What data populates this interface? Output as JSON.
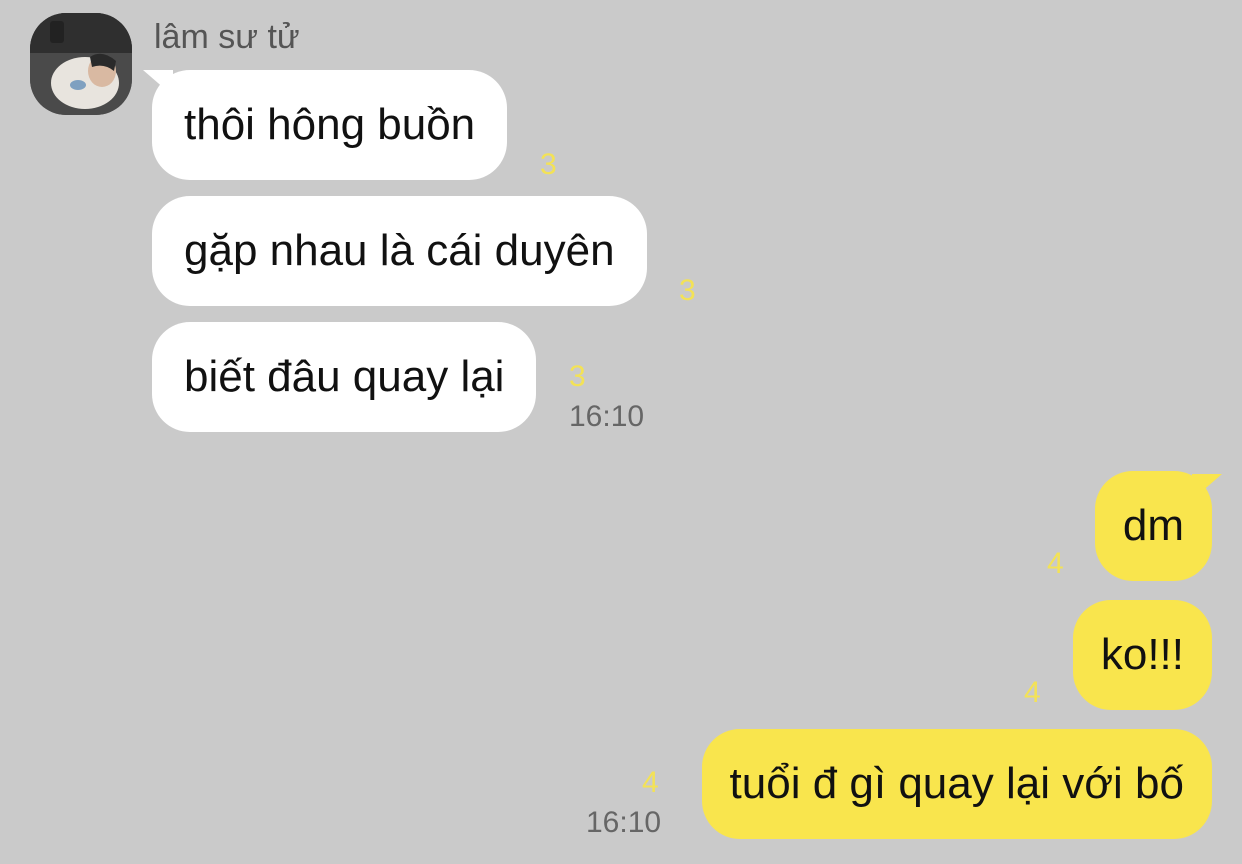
{
  "chat": {
    "sender_name": "lâm sư tử",
    "incoming": [
      {
        "text": "thôi hông buồn",
        "unread": "3"
      },
      {
        "text": "gặp nhau là cái duyên",
        "unread": "3"
      },
      {
        "text": "biết đâu quay lại",
        "unread": "3",
        "time": "16:10"
      }
    ],
    "outgoing": [
      {
        "text": "dm",
        "unread": "4"
      },
      {
        "text": "ko!!!",
        "unread": "4"
      },
      {
        "text": "tuổi đ gì quay lại với bố",
        "unread": "4",
        "time": "16:10"
      }
    ]
  },
  "colors": {
    "background": "#cacaca",
    "incoming_bubble": "#ffffff",
    "outgoing_bubble": "#f9e54d",
    "unread_count": "#f3e256"
  }
}
